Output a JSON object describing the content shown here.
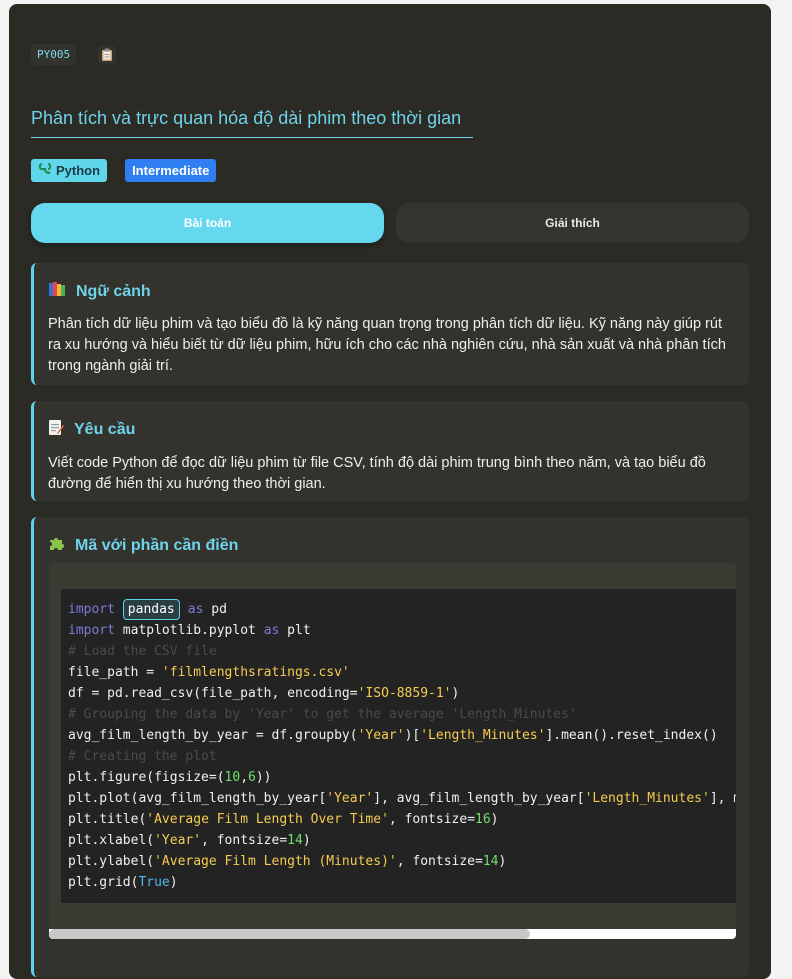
{
  "header": {
    "code_id": "PY005",
    "icon": "clipboard-icon",
    "title": "Phân tích và trực quan hóa độ dài phim theo thời gian"
  },
  "tags": {
    "language": "Python",
    "language_icon": "python-icon",
    "level": "Intermediate"
  },
  "tabs": [
    {
      "label": "Bài toán",
      "active": true
    },
    {
      "label": "Giải thích",
      "active": false
    }
  ],
  "context": {
    "icon": "books-icon",
    "title": "Ngữ cảnh",
    "body": "Phân tích dữ liệu phim và tạo biểu đồ là kỹ năng quan trọng trong phân tích dữ liệu. Kỹ năng này giúp rút ra xu hướng và hiểu biết từ dữ liệu phim, hữu ích cho các nhà nghiên cứu, nhà sản xuất và nhà phân tích trong ngành giải trí."
  },
  "requirement": {
    "icon": "memo-icon",
    "title": "Yêu cầu",
    "body": "Viết code Python để đọc dữ liệu phim từ file CSV, tính độ dài phim trung bình theo năm, và tạo biểu đồ đường để hiển thị xu hướng theo thời gian."
  },
  "code_section": {
    "icon": "puzzle-icon",
    "title": "Mã với phần cần điền",
    "blank_value": "pandas",
    "scroll_position": 0.7
  },
  "code_lines": [
    [
      {
        "t": "kw",
        "v": "import "
      },
      {
        "t": "blank",
        "v": "pandas"
      },
      {
        "t": "kw",
        "v": "as"
      },
      {
        "t": "",
        "v": " pd"
      }
    ],
    [
      {
        "t": "kw",
        "v": "import"
      },
      {
        "t": "",
        "v": " matplotlib.pyplot "
      },
      {
        "t": "kw",
        "v": "as"
      },
      {
        "t": "",
        "v": " plt"
      }
    ],
    [
      {
        "t": "cm",
        "v": "# Load the CSV file"
      }
    ],
    [
      {
        "t": "",
        "v": "file_path = "
      },
      {
        "t": "str",
        "v": "'filmlengthsratings.csv'"
      }
    ],
    [
      {
        "t": "",
        "v": "df = pd.read_csv(file_path, encoding="
      },
      {
        "t": "str",
        "v": "'ISO-8859-1'"
      },
      {
        "t": "",
        "v": ")"
      }
    ],
    [
      {
        "t": "cm",
        "v": "# Grouping the data by 'Year' to get the average 'Length_Minutes'"
      }
    ],
    [
      {
        "t": "",
        "v": "avg_film_length_by_year = df.groupby("
      },
      {
        "t": "str",
        "v": "'Year'"
      },
      {
        "t": "",
        "v": ")["
      },
      {
        "t": "str",
        "v": "'Length_Minutes'"
      },
      {
        "t": "",
        "v": "].mean().reset_index()"
      }
    ],
    [
      {
        "t": "cm",
        "v": "# Creating the plot"
      }
    ],
    [
      {
        "t": "",
        "v": "plt.figure(figsize=("
      },
      {
        "t": "num",
        "v": "10"
      },
      {
        "t": "",
        "v": ","
      },
      {
        "t": "num",
        "v": "6"
      },
      {
        "t": "",
        "v": "))"
      }
    ],
    [
      {
        "t": "",
        "v": "plt.plot(avg_film_length_by_year["
      },
      {
        "t": "str",
        "v": "'Year'"
      },
      {
        "t": "",
        "v": "], avg_film_length_by_year["
      },
      {
        "t": "str",
        "v": "'Length_Minutes'"
      },
      {
        "t": "",
        "v": "], ma"
      }
    ],
    [
      {
        "t": "",
        "v": "plt.title("
      },
      {
        "t": "str",
        "v": "'Average Film Length Over Time'"
      },
      {
        "t": "",
        "v": ", fontsize="
      },
      {
        "t": "num",
        "v": "16"
      },
      {
        "t": "",
        "v": ")"
      }
    ],
    [
      {
        "t": "",
        "v": "plt.xlabel("
      },
      {
        "t": "str",
        "v": "'Year'"
      },
      {
        "t": "",
        "v": ", fontsize="
      },
      {
        "t": "num",
        "v": "14"
      },
      {
        "t": "",
        "v": ")"
      }
    ],
    [
      {
        "t": "",
        "v": "plt.ylabel("
      },
      {
        "t": "str",
        "v": "'Average Film Length (Minutes)'"
      },
      {
        "t": "",
        "v": ", fontsize="
      },
      {
        "t": "num",
        "v": "14"
      },
      {
        "t": "",
        "v": ")"
      }
    ],
    [
      {
        "t": "",
        "v": "plt.grid("
      },
      {
        "t": "bool",
        "v": "True"
      },
      {
        "t": "",
        "v": ")"
      }
    ]
  ],
  "colors": {
    "accent": "#5fd3ea",
    "card_bg": "#2b2a25",
    "level_tag": "#2f7ef2"
  }
}
